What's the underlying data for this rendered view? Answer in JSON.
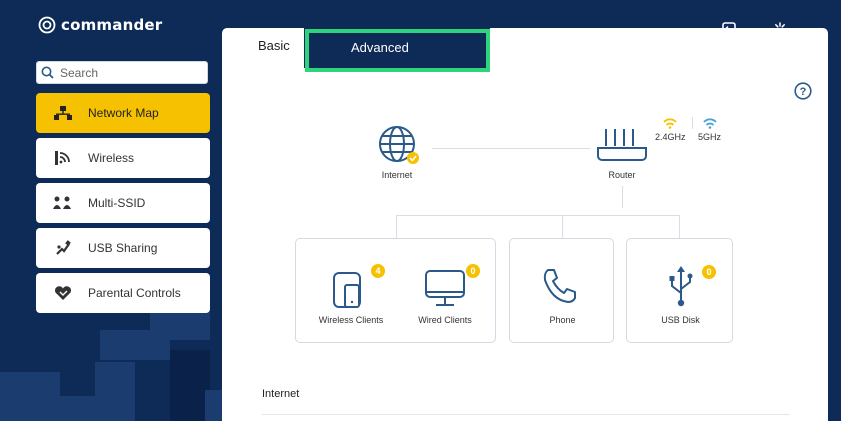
{
  "app": {
    "brand": "commander"
  },
  "search": {
    "placeholder": "Search"
  },
  "sidebar": {
    "items": [
      {
        "label": "Network Map",
        "icon": "network-map-icon",
        "active": true
      },
      {
        "label": "Wireless",
        "icon": "wireless-icon",
        "active": false
      },
      {
        "label": "Multi-SSID",
        "icon": "multi-ssid-icon",
        "active": false
      },
      {
        "label": "USB Sharing",
        "icon": "usb-sharing-icon",
        "active": false
      },
      {
        "label": "Parental Controls",
        "icon": "parental-controls-icon",
        "active": false
      }
    ]
  },
  "tabs": {
    "basic": "Basic",
    "advanced": "Advanced"
  },
  "header": {
    "logout": "Log out",
    "reboot": "Reboot"
  },
  "network": {
    "internet_label": "Internet",
    "router_label": "Router",
    "band_24": "2.4GHz",
    "band_5": "5GHz",
    "clients": [
      {
        "label": "Wireless Clients",
        "count": "4"
      },
      {
        "label": "Wired Clients",
        "count": "0"
      }
    ],
    "phone_label": "Phone",
    "usb": {
      "label": "USB Disk",
      "count": "0"
    }
  },
  "section": {
    "title": "Internet"
  },
  "colors": {
    "background": "#0e2b57",
    "accent": "#f6c100",
    "highlight": "#2fd47a",
    "icon": "#2b5a8a",
    "wifi5": "#4aa3d8"
  }
}
